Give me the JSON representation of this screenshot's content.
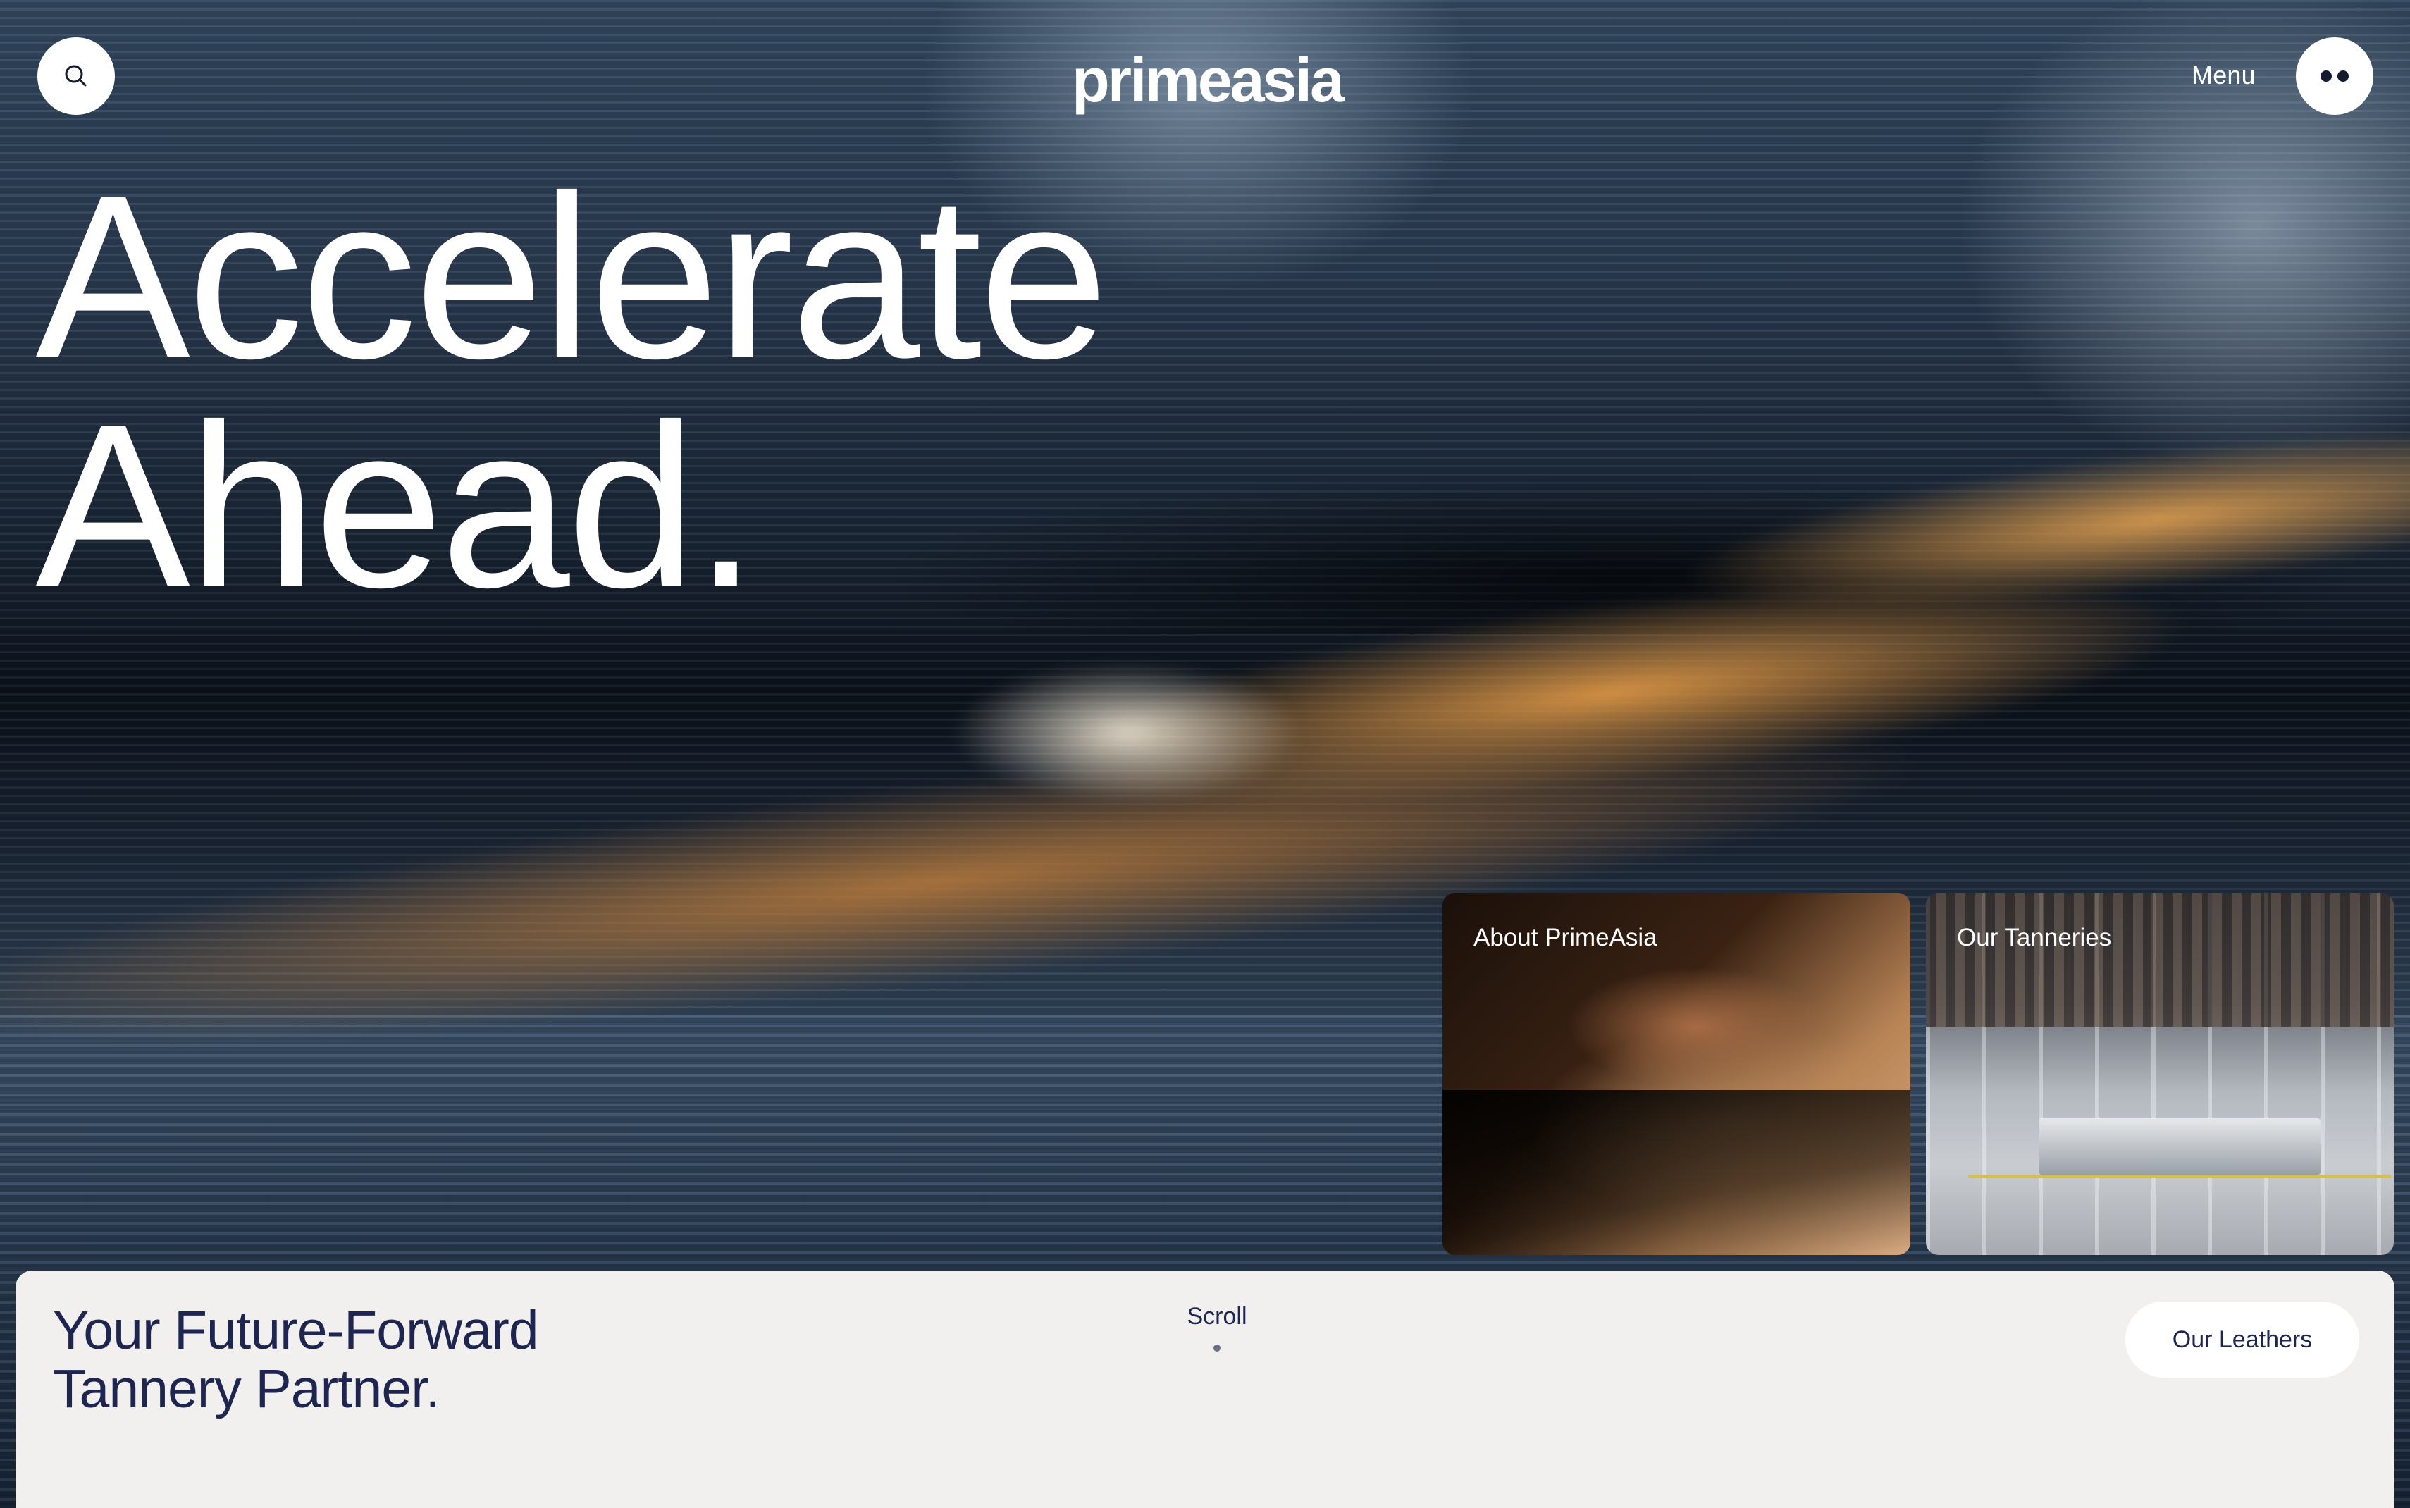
{
  "brand": {
    "logo_text": "primeasia"
  },
  "nav": {
    "search_icon": "search-icon",
    "menu_label": "Menu",
    "menu_icon": "two-dots-icon"
  },
  "hero": {
    "headline_line1": "Accelerate",
    "headline_line2": "Ahead."
  },
  "cards": [
    {
      "label": "About PrimeAsia"
    },
    {
      "label": "Our Tanneries"
    }
  ],
  "panel": {
    "tagline_line1": "Your Future-Forward",
    "tagline_line2": "Tannery Partner.",
    "scroll_label": "Scroll",
    "cta_label": "Our Leathers"
  },
  "colors": {
    "panel_bg": "#f1f0ee",
    "navy_text": "#1d2550",
    "white": "#ffffff"
  }
}
